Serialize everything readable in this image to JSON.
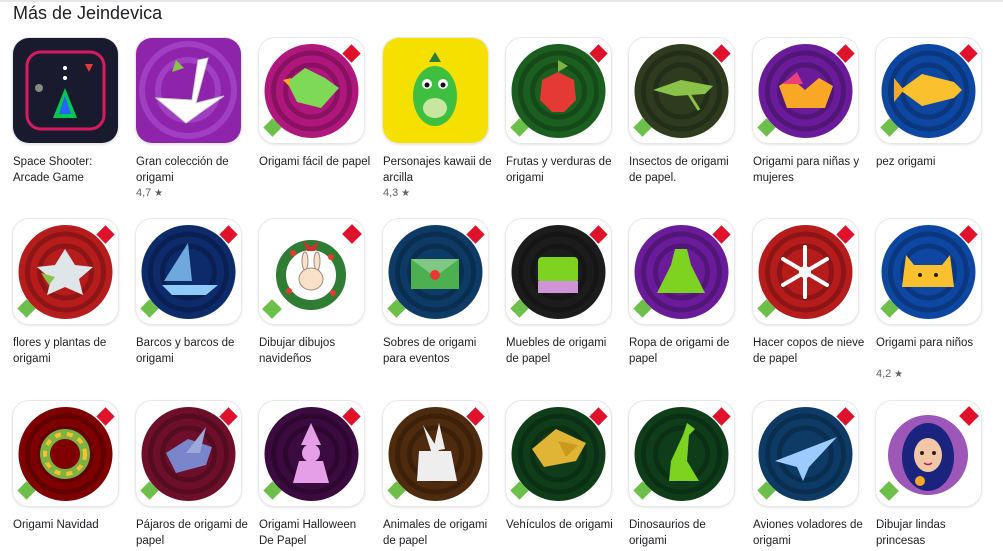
{
  "section": {
    "title": "Más de Jeindevica"
  },
  "apps": [
    {
      "name": "Space Shooter: Arcade Game",
      "rating": "",
      "icon": "space-shooter-icon",
      "style": "space",
      "ring": "#c2185b",
      "fill": "#1a1a2e"
    },
    {
      "name": "Gran colección de origami",
      "rating": "4,7",
      "icon": "swan-icon",
      "style": "purple",
      "ring": "#8e24aa",
      "fill": "#ffffff"
    },
    {
      "name": "Origami fácil de papel",
      "rating": "",
      "icon": "paper-bird-icon",
      "style": "round",
      "ring": "#b0177d",
      "fill": "#7ed957"
    },
    {
      "name": "Personajes kawaii de arcilla",
      "rating": "4,3",
      "icon": "dinosaur-clay-icon",
      "style": "yellow",
      "ring": "#f5e000",
      "fill": "#3fbf3f"
    },
    {
      "name": "Frutas y verduras de origami",
      "rating": "",
      "icon": "apple-icon",
      "style": "round",
      "ring": "#1b5e20",
      "fill": "#e53935"
    },
    {
      "name": "Insectos de origami de papel.",
      "rating": "",
      "icon": "grasshopper-icon",
      "style": "round",
      "ring": "#2e3b1f",
      "fill": "#8bc34a"
    },
    {
      "name": "Origami para niñas y mujeres",
      "rating": "",
      "icon": "crown-icon",
      "style": "round",
      "ring": "#6a1b9a",
      "fill": "#f9a825"
    },
    {
      "name": "pez origami",
      "rating": "",
      "icon": "fish-icon",
      "style": "round",
      "ring": "#0d47a1",
      "fill": "#fbc02d"
    },
    {
      "name": "flores y plantas de origami",
      "rating": "",
      "icon": "flower-icon",
      "style": "round",
      "ring": "#b71c1c",
      "fill": "#dfe6e9"
    },
    {
      "name": "Barcos y barcos de origami",
      "rating": "",
      "icon": "boat-icon",
      "style": "round",
      "ring": "#0d2a6b",
      "fill": "#6fa8dc"
    },
    {
      "name": "Dibujar dibujos navideños",
      "rating": "",
      "icon": "bunny-wreath-icon",
      "style": "white",
      "ring": "#2e7d32",
      "fill": "#f8e1c8"
    },
    {
      "name": "Sobres de origami para eventos",
      "rating": "",
      "icon": "envelope-icon",
      "style": "round",
      "ring": "#0d3b66",
      "fill": "#4caf50"
    },
    {
      "name": "Muebles de origami de papel",
      "rating": "",
      "icon": "armchair-icon",
      "style": "round",
      "ring": "#1c1c1c",
      "fill": "#7ed321"
    },
    {
      "name": "Ropa de origami de papel",
      "rating": "",
      "icon": "dress-icon",
      "style": "round",
      "ring": "#6a1b9a",
      "fill": "#7ed321"
    },
    {
      "name": "Hacer copos de nieve de papel",
      "rating": "",
      "icon": "snowflake-icon",
      "style": "round",
      "ring": "#b71c1c",
      "fill": "#ffffff"
    },
    {
      "name": "Origami para niños",
      "rating": "4,2",
      "icon": "cat-icon",
      "style": "round",
      "ring": "#0d47a1",
      "fill": "#fbc02d"
    },
    {
      "name": "Origami Navidad",
      "rating": "",
      "icon": "wreath-icon",
      "style": "round",
      "ring": "#7f0000",
      "fill": "#7cb342"
    },
    {
      "name": "Pájaros de origami de papel",
      "rating": "",
      "icon": "bird-icon",
      "style": "round",
      "ring": "#6d0f2a",
      "fill": "#7986cb"
    },
    {
      "name": "Origami Halloween De Papel",
      "rating": "",
      "icon": "witch-icon",
      "style": "round",
      "ring": "#3b0a3f",
      "fill": "#e49fe6"
    },
    {
      "name": "Animales de origami de papel",
      "rating": "",
      "icon": "rabbit-icon",
      "style": "round",
      "ring": "#4e2a0e",
      "fill": "#eeeeee"
    },
    {
      "name": "Vehículos de origami",
      "rating": "",
      "icon": "car-icon",
      "style": "round",
      "ring": "#0f3d1a",
      "fill": "#e0b435"
    },
    {
      "name": "Dinosaurios de origami",
      "rating": "",
      "icon": "dinosaur-icon",
      "style": "round",
      "ring": "#0f3d1a",
      "fill": "#7ed321"
    },
    {
      "name": "Aviones voladores de origami",
      "rating": "",
      "icon": "plane-icon",
      "style": "round",
      "ring": "#0d3b66",
      "fill": "#9ecbff"
    },
    {
      "name": "Dibujar lindas princesas",
      "rating": "",
      "icon": "princess-icon",
      "style": "white",
      "ring": "#7b1fa2",
      "fill": "#1a237e"
    }
  ]
}
